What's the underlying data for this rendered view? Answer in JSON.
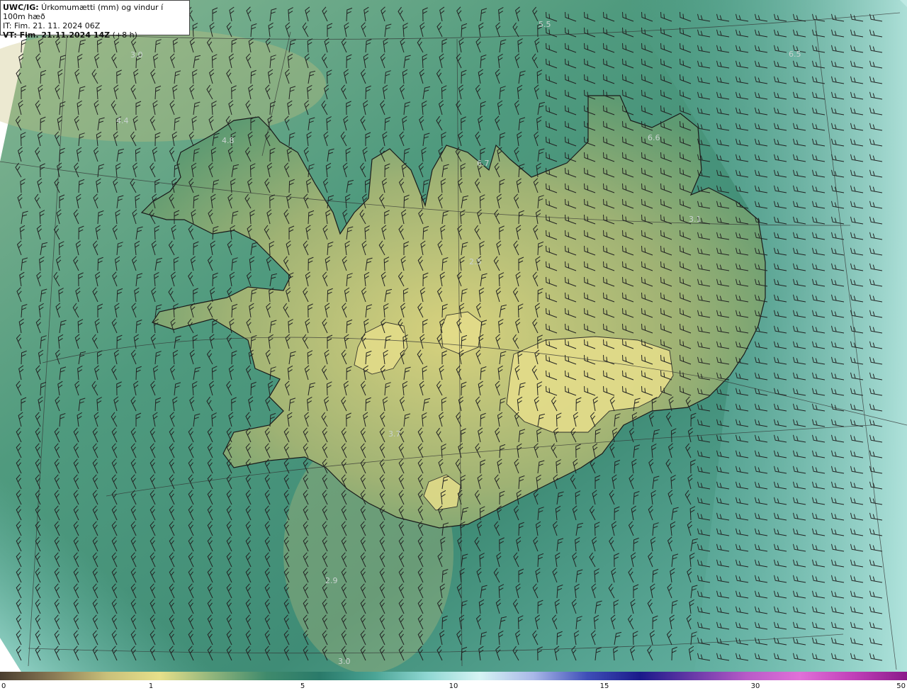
{
  "header": {
    "line1_bold": "UWC/IG:",
    "line1_rest": " Úrkomumætti (mm) og vindur í 100m hæð",
    "line2": "IT: Fim. 21. 11. 2024 06Z",
    "line3_bold": "VT: Fim. 21.11.2024 14Z",
    "line3_rest": " (+8 h)"
  },
  "map_labels": [
    "5.5",
    "6.5",
    "3.0",
    "4.4",
    "4.8",
    "6.6",
    "6.7",
    "3.1",
    "2.5",
    "3.7",
    "2.9",
    "3.0"
  ],
  "colorbar": {
    "ticks": [
      "0",
      "1",
      "5",
      "10",
      "15",
      "30",
      "50"
    ],
    "colors": [
      "#4a3d2e",
      "#8a7a55",
      "#c9c07a",
      "#e6e08a",
      "#8fb47c",
      "#3f8a6c",
      "#2a7a6a",
      "#4aa394",
      "#8fd7d2",
      "#d6f4f4",
      "#a9b8e8",
      "#3f4fb8",
      "#1a1a8a",
      "#6a3aa8",
      "#b85bc8",
      "#e070d8",
      "#c040b8",
      "#8a1a8a"
    ]
  }
}
